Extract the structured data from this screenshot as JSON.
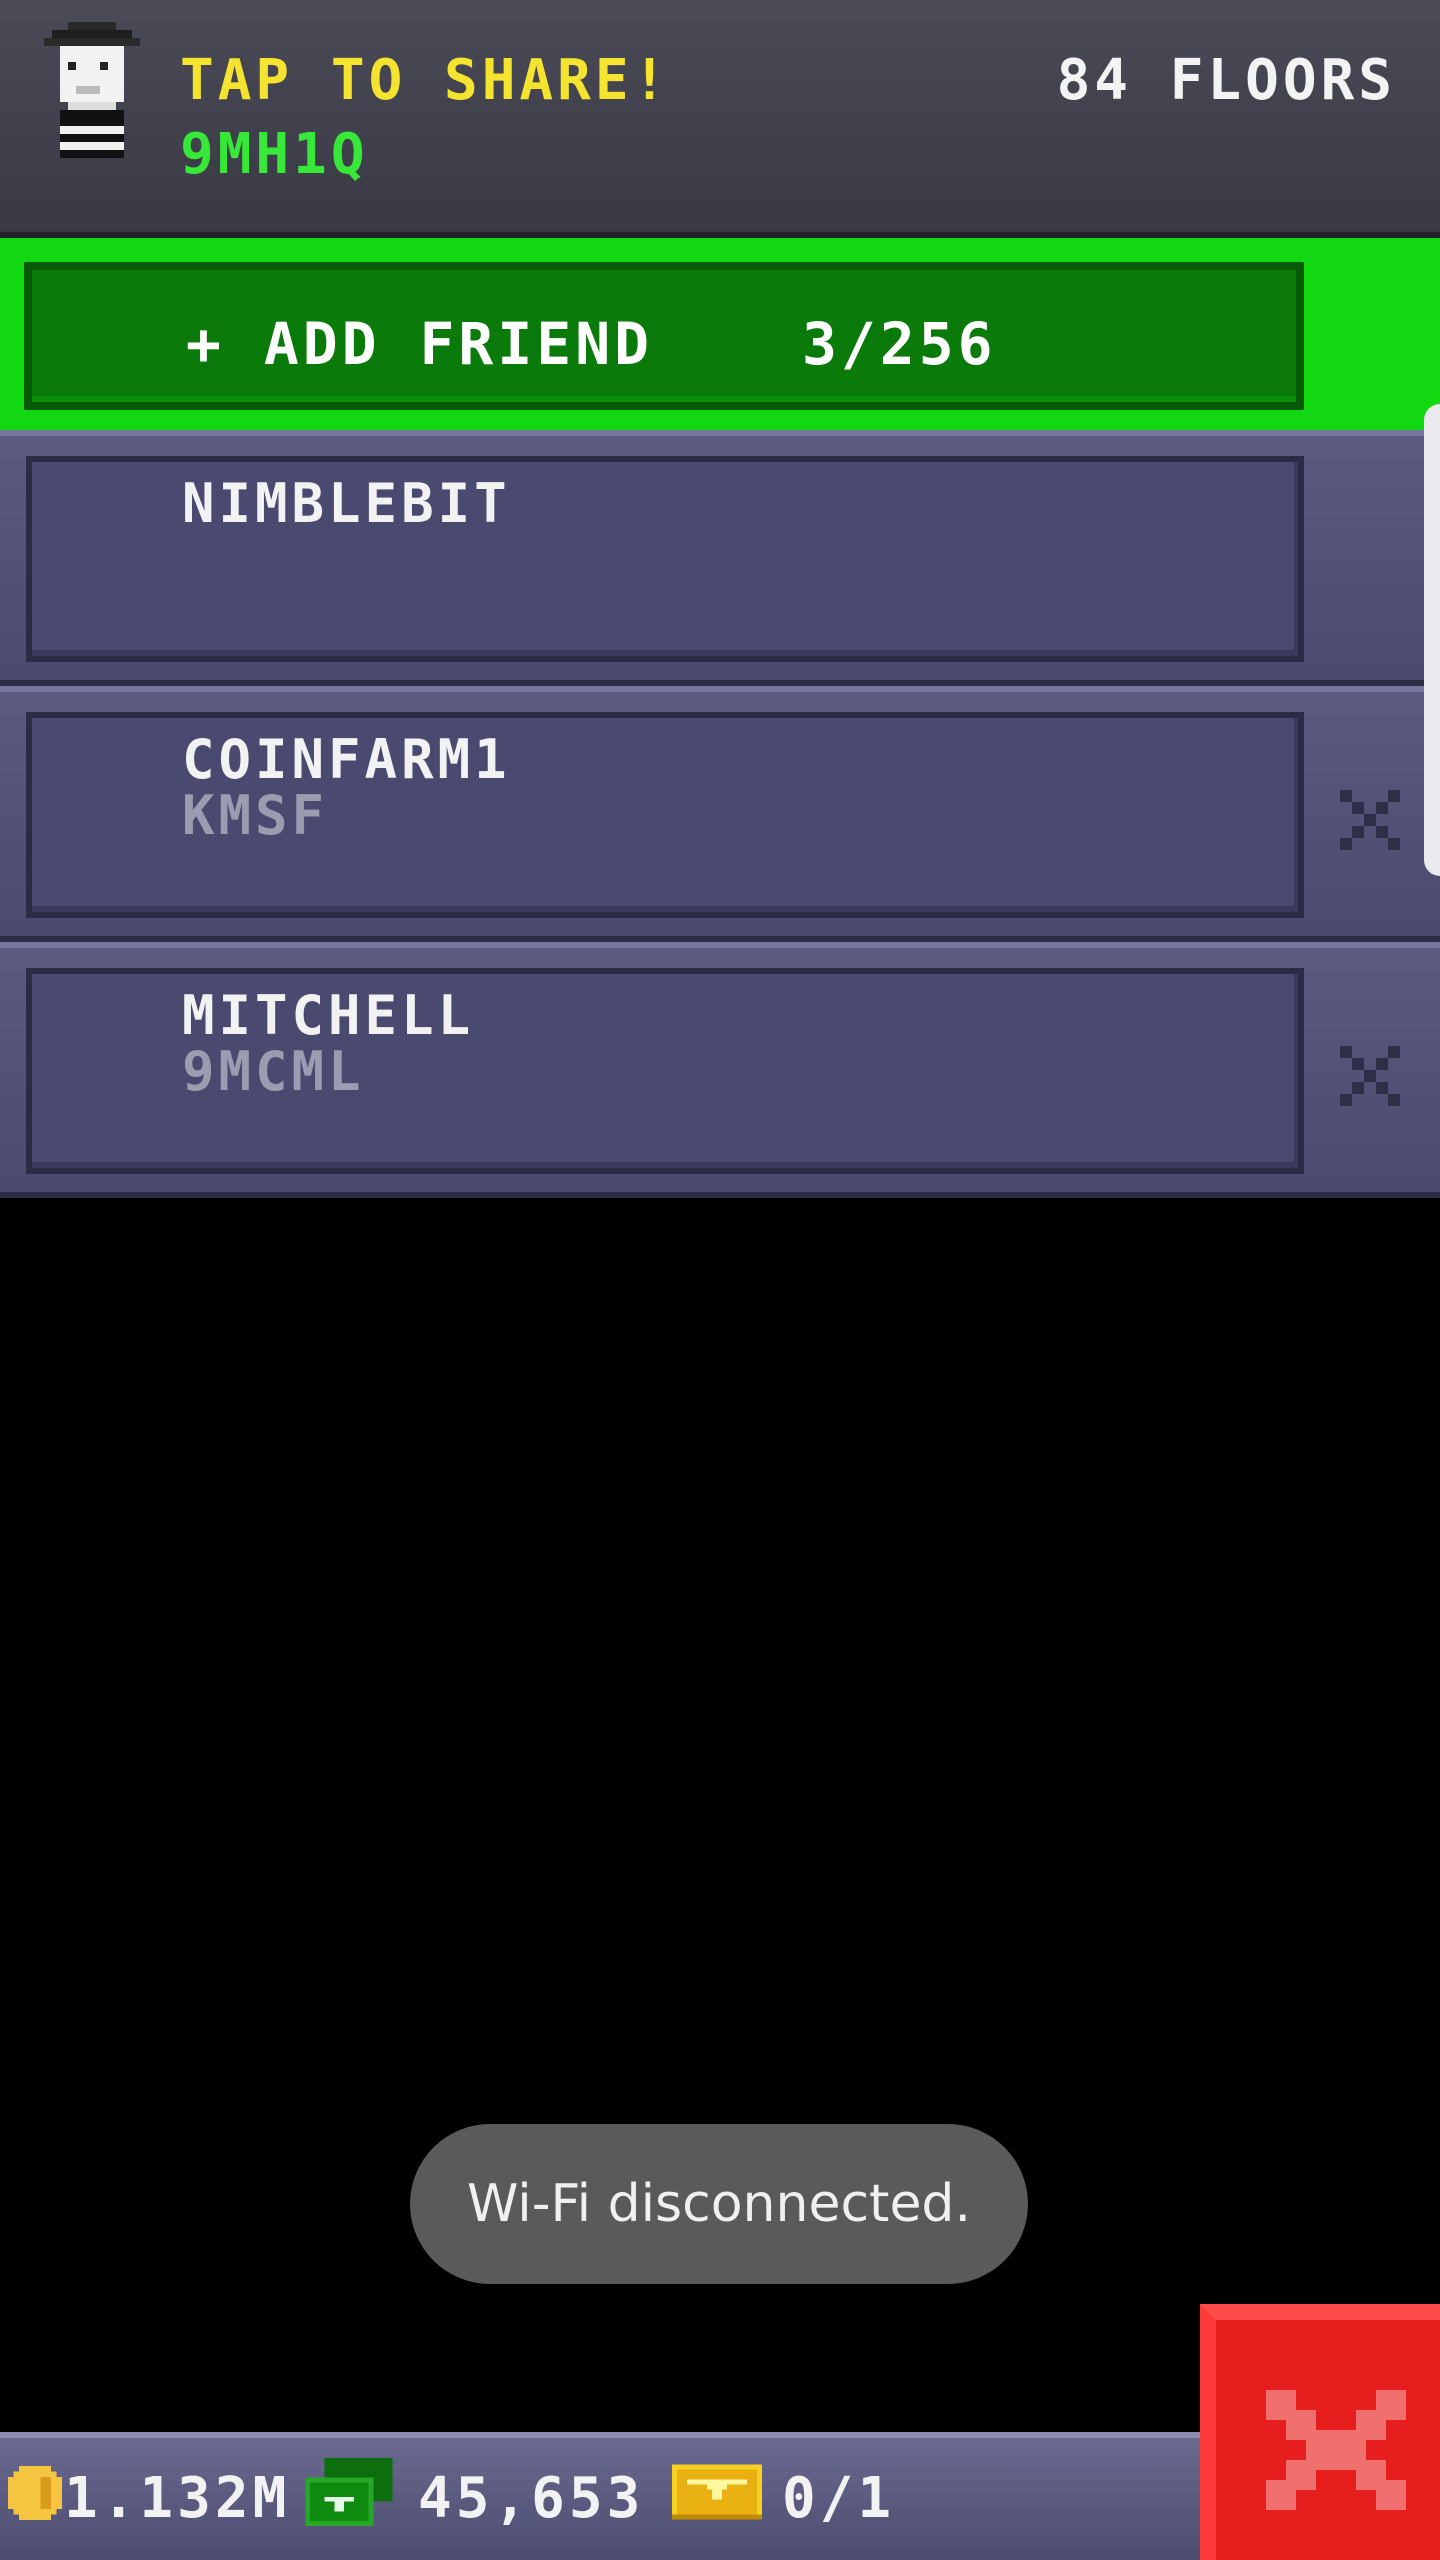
{
  "header": {
    "share_title": "TAP TO SHARE!",
    "share_code": "9MH1Q",
    "floors": "84 FLOORS",
    "avatar_icon": "bitizen-avatar-icon"
  },
  "add_friend": {
    "label": "+ ADD FRIEND",
    "count": "3/256",
    "bar_color": "#12d812"
  },
  "friends": [
    {
      "name": "NIMBLEBIT",
      "code": "",
      "removable": false
    },
    {
      "name": "COINFARM1",
      "code": "KMSF",
      "removable": true
    },
    {
      "name": "MITCHELL",
      "code": "9MCML",
      "removable": true
    }
  ],
  "toast": {
    "message": "Wi-Fi disconnected."
  },
  "bottom_bar": {
    "coins": "1.132M",
    "cash": "45,653",
    "bux_tickets": "0/1",
    "icons": [
      "coin-icon",
      "cash-icon",
      "golden-ticket-icon"
    ]
  },
  "close_button": {
    "icon": "close-x-icon",
    "color": "#e61e1e"
  }
}
